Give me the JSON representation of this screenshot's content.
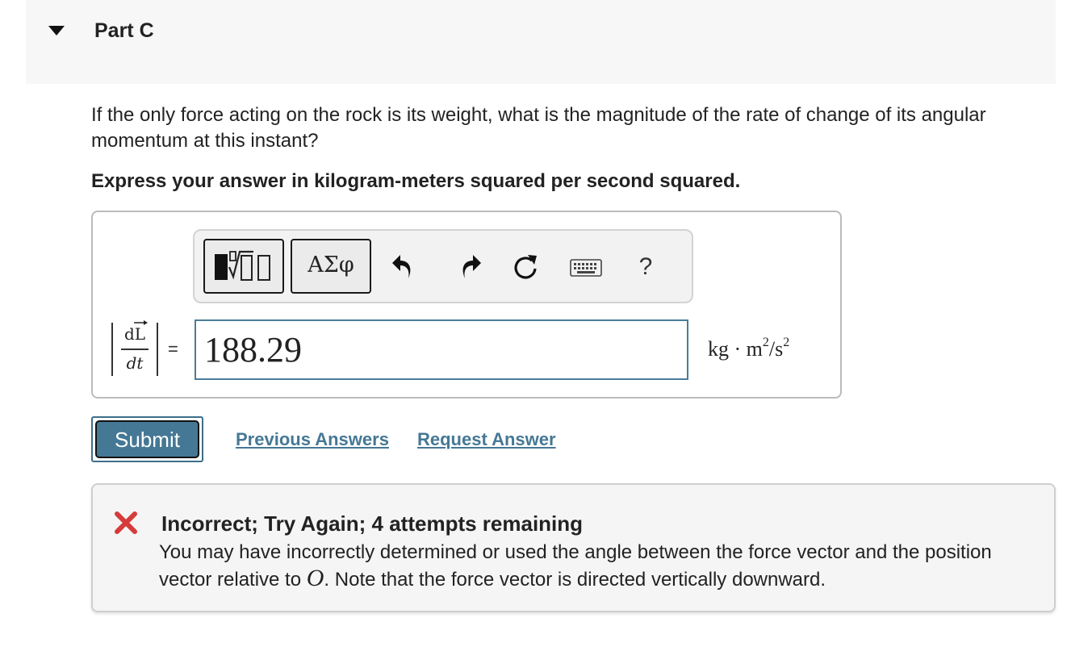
{
  "part": {
    "title": "Part C"
  },
  "question": {
    "text": "If the only force acting on the rock is its weight, what is the magnitude of the rate of change of its angular momentum at this instant?",
    "instruction": "Express your answer in kilogram-meters squared per second squared."
  },
  "toolbar": {
    "symbols_label": "ΑΣφ",
    "help_label": "?",
    "icons": [
      "templates-icon",
      "undo-icon",
      "redo-icon",
      "reset-icon",
      "keyboard-icon",
      "help-icon"
    ]
  },
  "answer": {
    "lhs_numerator": "dL",
    "lhs_denominator": "dt",
    "equals": "=",
    "value": "188.29",
    "unit_base": "kg · m",
    "unit_exp1": "2",
    "unit_sep": "/s",
    "unit_exp2": "2"
  },
  "actions": {
    "submit_label": "Submit",
    "previous_answers_label": "Previous Answers",
    "request_answer_label": "Request Answer"
  },
  "feedback": {
    "title": "Incorrect; Try Again; 4 attempts remaining",
    "text_before": "You may have incorrectly determined or used the angle between the force vector and the position vector relative to ",
    "variable": "O",
    "text_after": ". Note that the force vector is directed vertically downward."
  },
  "colors": {
    "accent": "#457895",
    "error": "#d63b3b",
    "header_bg": "#f7f7f7"
  }
}
